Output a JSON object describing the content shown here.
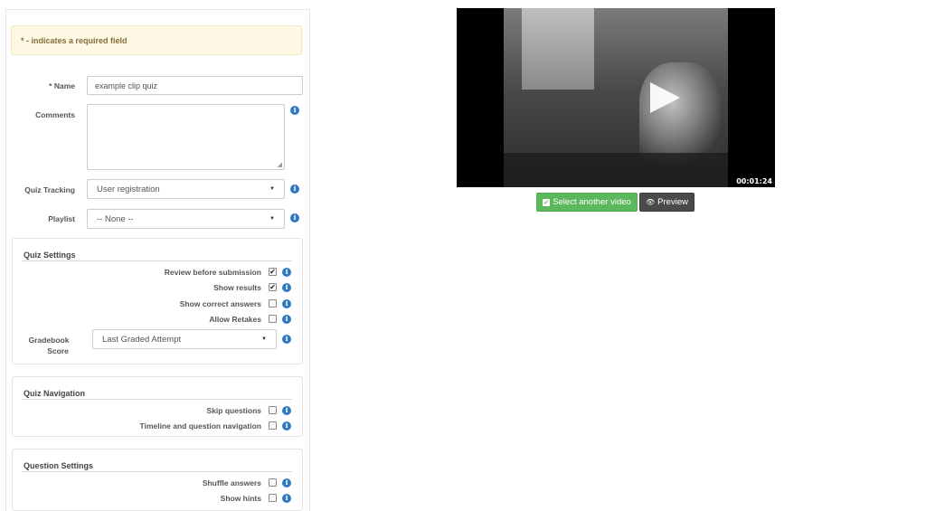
{
  "form": {
    "required_notice": "* - indicates a required field",
    "name_label": "* Name",
    "name_value": "example clip quiz",
    "comments_label": "Comments",
    "comments_value": "",
    "quiz_tracking_label": "Quiz Tracking",
    "quiz_tracking_value": "User registration",
    "playlist_label": "Playlist",
    "playlist_value": "-- None --"
  },
  "quiz_settings": {
    "legend": "Quiz Settings",
    "items": [
      {
        "label": "Review before submission",
        "checked": true
      },
      {
        "label": "Show results",
        "checked": true
      },
      {
        "label": "Show correct answers",
        "checked": false
      },
      {
        "label": "Allow Retakes",
        "checked": false
      }
    ],
    "gradebook_label_line1": "Gradebook",
    "gradebook_label_line2": "Score",
    "gradebook_value": "Last Graded Attempt"
  },
  "quiz_navigation": {
    "legend": "Quiz Navigation",
    "items": [
      {
        "label": "Skip questions",
        "checked": false
      },
      {
        "label": "Timeline and question navigation",
        "checked": false
      }
    ]
  },
  "question_settings": {
    "legend": "Question Settings",
    "items": [
      {
        "label": "Shuffle answers",
        "checked": false
      },
      {
        "label": "Show hints",
        "checked": false
      }
    ]
  },
  "video": {
    "timecode": "00:01:24"
  },
  "buttons": {
    "select_video": "Select another video",
    "preview": "Preview"
  },
  "icons": {
    "info": "i",
    "checkmark": "✔",
    "caret": "▼",
    "eye": "👁",
    "resize": "◢"
  },
  "colors": {
    "info_blue": "#2f79c2",
    "green": "#5cb85c",
    "dark": "#4a4a4a",
    "alert_bg": "#fcf8e3",
    "alert_text": "#8a6d3b"
  }
}
